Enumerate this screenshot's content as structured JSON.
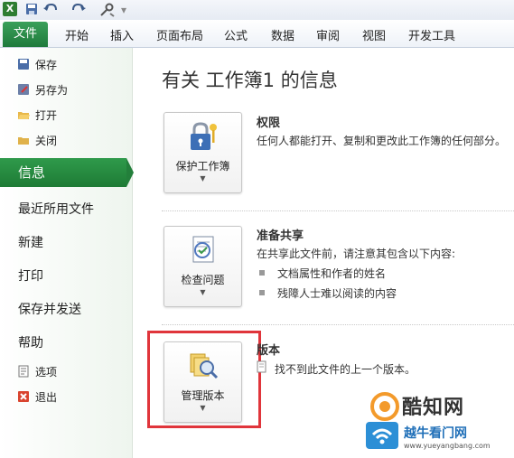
{
  "qat": {
    "logo_letter": "X"
  },
  "ribbon": {
    "file": "文件",
    "tabs": [
      "开始",
      "插入",
      "页面布局",
      "公式",
      "数据",
      "审阅",
      "视图",
      "开发工具"
    ]
  },
  "nav": {
    "save": "保存",
    "save_as": "另存为",
    "open": "打开",
    "close": "关闭",
    "info": "信息",
    "recent": "最近所用文件",
    "new": "新建",
    "print": "打印",
    "save_send": "保存并发送",
    "help": "帮助",
    "options": "选项",
    "exit": "退出"
  },
  "main": {
    "title": "有关 工作簿1 的信息",
    "permissions": {
      "button": "保护工作簿",
      "title": "权限",
      "text": "任何人都能打开、复制和更改此工作簿的任何部分。"
    },
    "share": {
      "button": "检查问题",
      "title": "准备共享",
      "text": "在共享此文件前，请注意其包含以下内容:",
      "bullets": [
        "文档属性和作者的姓名",
        "残障人士难以阅读的内容"
      ]
    },
    "versions": {
      "button": "管理版本",
      "title": "版本",
      "text": "找不到此文件的上一个版本。"
    }
  },
  "watermark": {
    "brand": "酷知网",
    "tagline": "越牛看门网",
    "url": "www.yueyangbang.com"
  },
  "colors": {
    "accent_green": "#1f7a3c",
    "highlight_red": "#e0353b"
  }
}
